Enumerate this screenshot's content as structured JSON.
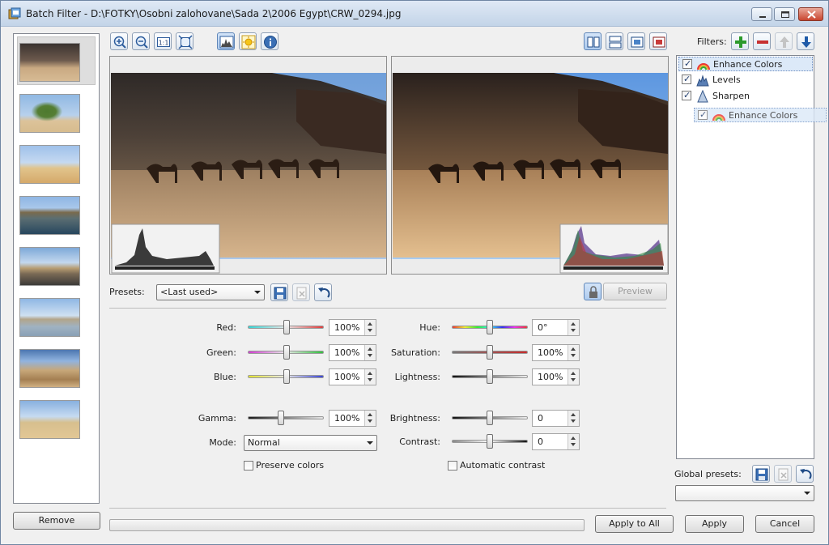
{
  "window": {
    "title": "Batch Filter - D:\\FOTKY\\Osobni zalohovane\\Sada 2\\2006 Egypt\\CRW_0294.jpg"
  },
  "toolbar": {
    "icons": [
      "zoom-in-icon",
      "zoom-out-icon",
      "actual-size-icon",
      "fit-icon",
      "histogram-icon",
      "sun-icon",
      "info-icon"
    ],
    "layout_icons": [
      "split-vertical-icon",
      "split-horizontal-icon",
      "single-original-icon",
      "single-processed-icon"
    ]
  },
  "presets": {
    "label": "Presets:",
    "value": "<Last used>"
  },
  "preview_label": "Preview",
  "left_sliders": [
    {
      "label": "Red:",
      "value": "100%"
    },
    {
      "label": "Green:",
      "value": "100%"
    },
    {
      "label": "Blue:",
      "value": "100%"
    },
    {
      "label": "Gamma:",
      "value": "100%"
    }
  ],
  "right_sliders": [
    {
      "label": "Hue:",
      "value": "0°"
    },
    {
      "label": "Saturation:",
      "value": "100%"
    },
    {
      "label": "Lightness:",
      "value": "100%"
    },
    {
      "label": "Brightness:",
      "value": "0"
    },
    {
      "label": "Contrast:",
      "value": "0"
    }
  ],
  "mode": {
    "label": "Mode:",
    "value": "Normal"
  },
  "preserve_colors": {
    "label": "Preserve colors",
    "checked": false
  },
  "automatic_contrast": {
    "label": "Automatic contrast",
    "checked": false
  },
  "filters": {
    "label": "Filters:",
    "items": [
      {
        "label": "Enhance Colors",
        "checked": true,
        "selected": true
      },
      {
        "label": "Levels",
        "checked": true
      },
      {
        "label": "Sharpen",
        "checked": true
      }
    ],
    "drag_item": {
      "label": "Enhance Colors"
    }
  },
  "global_presets": {
    "label": "Global presets:",
    "value": ""
  },
  "buttons": {
    "remove": "Remove",
    "apply_all": "Apply to All",
    "apply": "Apply",
    "cancel": "Cancel"
  },
  "progress": 0,
  "colors": {
    "accent": "#3a6fb5",
    "selection": "#dce9f8"
  }
}
